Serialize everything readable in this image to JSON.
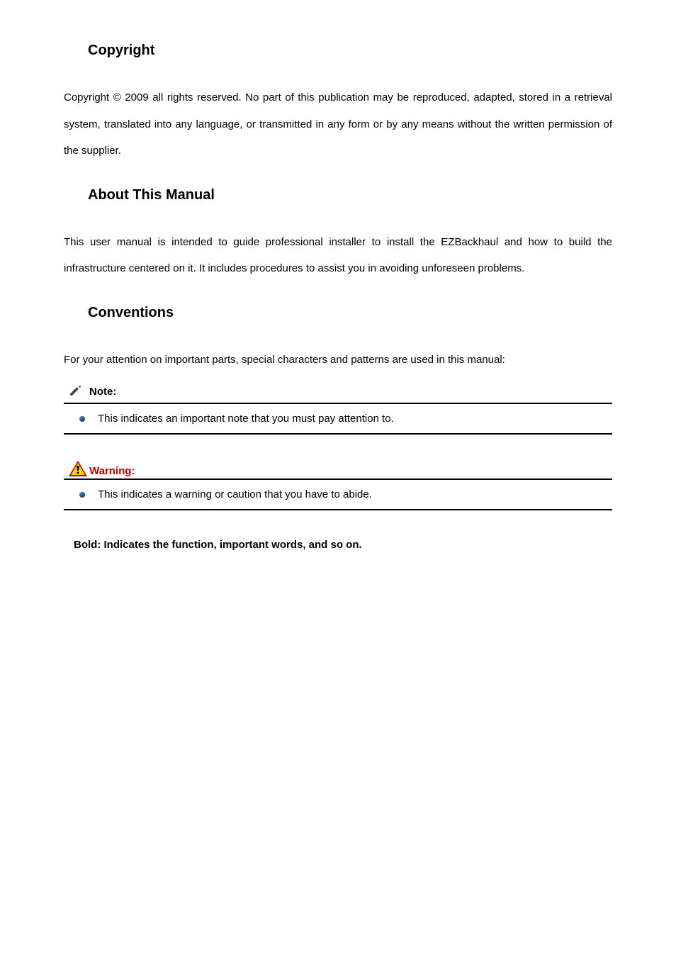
{
  "sections": {
    "copyright": {
      "heading": "Copyright",
      "body": "Copyright © 2009 all rights reserved. No part of this publication may be reproduced, adapted, stored in a retrieval system, translated into any language, or transmitted in any form or by any means without the written permission of the supplier."
    },
    "about": {
      "heading": "About This Manual",
      "body": "This user manual is intended to guide professional installer to install the EZBackhaul and how to build the infrastructure centered on it. It includes procedures to assist you in avoiding unforeseen problems."
    },
    "conventions": {
      "heading": "Conventions",
      "body": "For your attention on important parts, special characters and patterns are used in this manual:",
      "note": {
        "label": "Note:",
        "text": "This indicates an important note that you must pay attention to."
      },
      "warning": {
        "label": "Warning:",
        "text": "This indicates a warning or caution that you have to abide."
      },
      "bold_note": "Bold: Indicates the function, important words, and so on."
    }
  }
}
